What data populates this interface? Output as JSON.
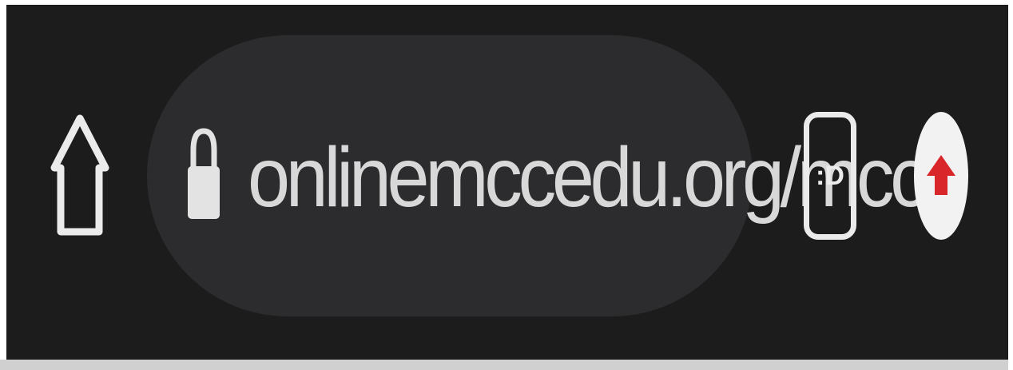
{
  "toolbar": {
    "url": "onlinemccedu.org/mcce",
    "tab_count": ":D",
    "icons": {
      "home": "home-icon",
      "lock": "lock-icon",
      "tabs": "tab-switcher-icon",
      "update": "update-arrow-icon"
    },
    "colors": {
      "toolbar_bg": "#1c1c1d",
      "omnibox_bg": "#2c2c2e",
      "text": "#d8d8d8",
      "update_arrow": "#d8262b"
    }
  }
}
